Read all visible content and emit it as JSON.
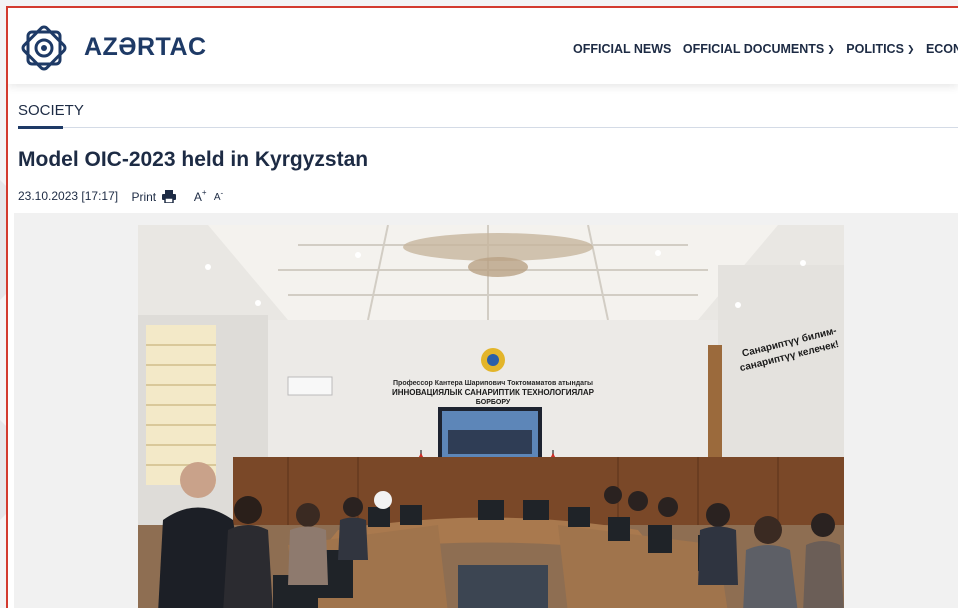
{
  "brand": {
    "name": "AZƏRTAC"
  },
  "nav": {
    "items": [
      {
        "label": "OFFICIAL NEWS",
        "dropdown": false
      },
      {
        "label": "OFFICIAL DOCUMENTS",
        "dropdown": true
      },
      {
        "label": "POLITICS",
        "dropdown": true
      },
      {
        "label": "ECON",
        "dropdown": false
      }
    ]
  },
  "section": {
    "label": "SOCIETY"
  },
  "article": {
    "title": "Model OIC-2023 held in Kyrgyzstan",
    "datetime": "23.10.2023 [17:17]",
    "print_label": "Print",
    "font_increase": "A",
    "font_decrease": "A"
  },
  "photo": {
    "sign_line1": "Профессор Кантера Шарипович Токтомаматов атындагы",
    "sign_line2": "ИННОВАЦИЯЛЫК САНАРИПТИК ТЕХНОЛОГИЯЛАР",
    "sign_line3": "БОРБОРУ",
    "pillar_line1": "Санариптүү билим-",
    "pillar_line2": "санариптүү келечек!"
  },
  "colors": {
    "accent_red": "#d33a2f",
    "brand_blue": "#1e3a66",
    "text_dark": "#1d2b44",
    "rule": "#d4dbe6"
  },
  "icons": [
    "azertac-logo-icon",
    "chevron-down-icon",
    "printer-icon"
  ]
}
